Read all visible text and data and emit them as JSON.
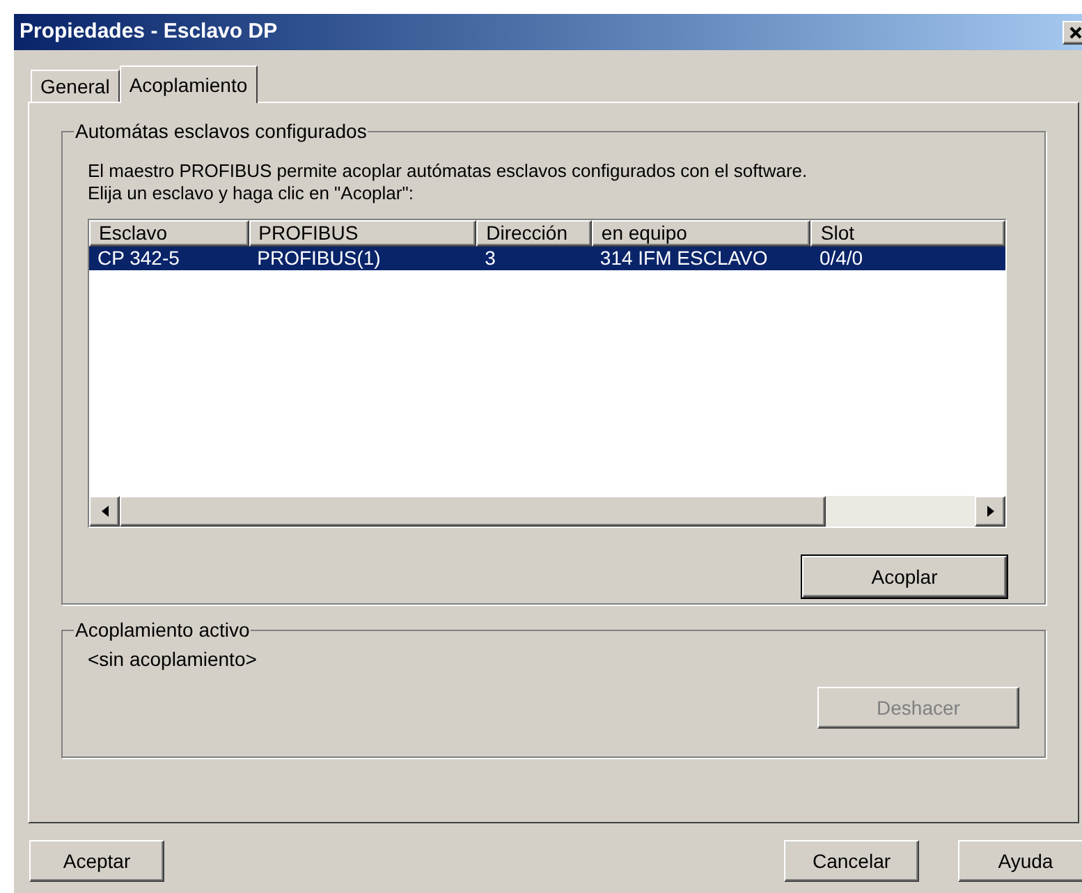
{
  "window": {
    "title": "Propiedades - Esclavo DP"
  },
  "tabs": [
    {
      "label": "General",
      "selected": false
    },
    {
      "label": "Acoplamiento",
      "selected": true
    }
  ],
  "configured_group": {
    "title": "Automátas esclavos configurados",
    "description": [
      "El maestro PROFIBUS permite acoplar autómatas esclavos configurados con el software.",
      "Elija un esclavo y haga clic en \"Acoplar\":"
    ],
    "table": {
      "columns": [
        "Esclavo",
        "PROFIBUS",
        "Dirección",
        "en equipo",
        "Slot"
      ],
      "rows": [
        {
          "cells": [
            "CP 342-5",
            "PROFIBUS(1)",
            "3",
            "314 IFM ESCLAVO",
            "0/4/0"
          ],
          "selected": true
        }
      ]
    },
    "button": {
      "label": "Acoplar",
      "disabled": false
    }
  },
  "active_group": {
    "title": "Acoplamiento activo",
    "value": "<sin acoplamiento>",
    "button": {
      "label": "Deshacer",
      "disabled": true
    }
  },
  "footer_buttons": [
    "Aceptar",
    "Cancelar",
    "Ayuda"
  ]
}
